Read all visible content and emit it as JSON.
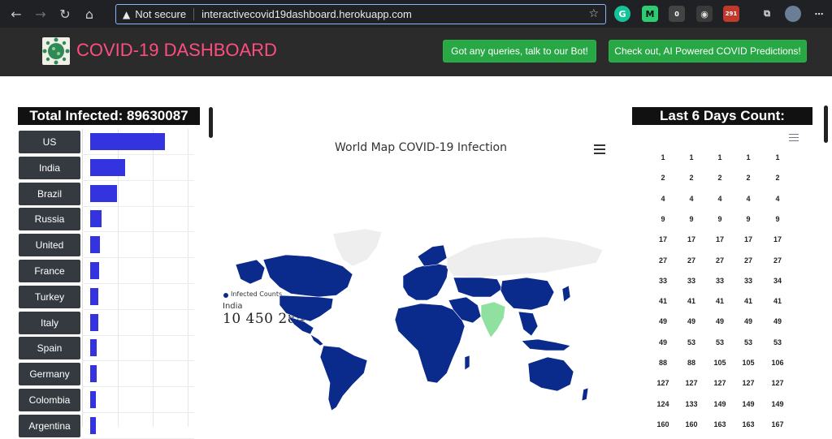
{
  "browser": {
    "not_secure": "Not secure",
    "url": "interactivecovid19dashboard.herokuapp.com",
    "ext_badge_1": "0",
    "ext_badge_2": "291"
  },
  "header": {
    "title": "COVID-19 DASHBOARD",
    "bot_button": "Got any queries, talk to our Bot!",
    "predictions_button": "Check out, AI Powered COVID Predictions!",
    "title_color": "#ff4d80",
    "button_color": "#28a745"
  },
  "left": {
    "total_label": "Total Infected: 89630087",
    "countries": [
      {
        "name": "US",
        "bar_fraction": 0.67
      },
      {
        "name": "India",
        "bar_fraction": 0.31
      },
      {
        "name": "Brazil",
        "bar_fraction": 0.24
      },
      {
        "name": "Russia",
        "bar_fraction": 0.1
      },
      {
        "name": "United",
        "bar_fraction": 0.09
      },
      {
        "name": "France",
        "bar_fraction": 0.08
      },
      {
        "name": "Turkey",
        "bar_fraction": 0.07
      },
      {
        "name": "Italy",
        "bar_fraction": 0.07
      },
      {
        "name": "Spain",
        "bar_fraction": 0.06
      },
      {
        "name": "Germany",
        "bar_fraction": 0.06
      },
      {
        "name": "Colombia",
        "bar_fraction": 0.05
      },
      {
        "name": "Argentina",
        "bar_fraction": 0.05
      }
    ],
    "bar_color": "#3333e0"
  },
  "map": {
    "title": "World Map COVID-19 Infection",
    "legend_label": "Infected Counts",
    "hover_country": "India",
    "hover_value": "10 450 284",
    "infected_color": "#0a2a8c",
    "hover_color": "#90e0a0"
  },
  "right": {
    "title": "Last 6 Days Count:",
    "rows": [
      [
        "1",
        "1",
        "1",
        "1",
        "1"
      ],
      [
        "2",
        "2",
        "2",
        "2",
        "2"
      ],
      [
        "4",
        "4",
        "4",
        "4",
        "4"
      ],
      [
        "9",
        "9",
        "9",
        "9",
        "9"
      ],
      [
        "17",
        "17",
        "17",
        "17",
        "17"
      ],
      [
        "27",
        "27",
        "27",
        "27",
        "27"
      ],
      [
        "33",
        "33",
        "33",
        "33",
        "34"
      ],
      [
        "41",
        "41",
        "41",
        "41",
        "41"
      ],
      [
        "49",
        "49",
        "49",
        "49",
        "49"
      ],
      [
        "49",
        "53",
        "53",
        "53",
        "53"
      ],
      [
        "88",
        "88",
        "105",
        "105",
        "106"
      ],
      [
        "127",
        "127",
        "127",
        "127",
        "127"
      ],
      [
        "124",
        "133",
        "149",
        "149",
        "149"
      ],
      [
        "160",
        "160",
        "163",
        "163",
        "167"
      ]
    ]
  }
}
